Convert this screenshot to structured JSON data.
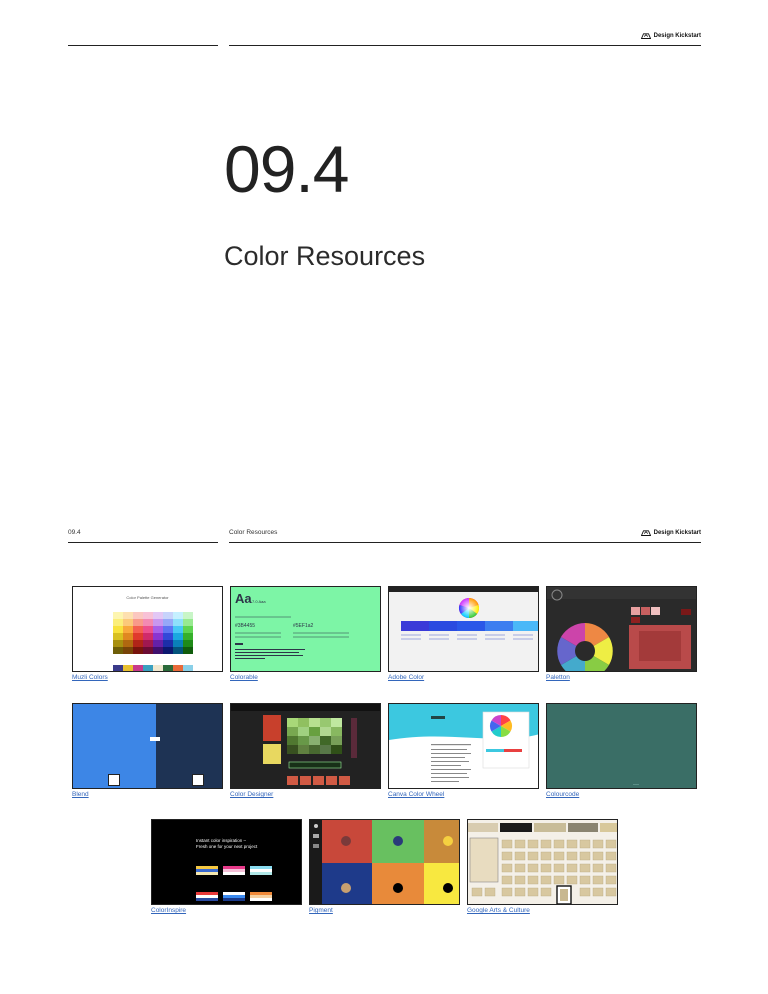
{
  "page1": {
    "brand": "Design Kickstart",
    "chapter_number": "09.4",
    "chapter_title": "Color Resources"
  },
  "page2": {
    "section_number": "09.4",
    "section_title": "Color Resources",
    "brand": "Design Kickstart",
    "resources": [
      {
        "name": "Muzli Colors"
      },
      {
        "name": "Colorable"
      },
      {
        "name": "Adobe Color"
      },
      {
        "name": "Paletton"
      },
      {
        "name": "Blend"
      },
      {
        "name": "Color Designer"
      },
      {
        "name": "Canva Color Wheel"
      },
      {
        "name": "Colourcode"
      },
      {
        "name": "ColorInspire"
      },
      {
        "name": "Pigment"
      },
      {
        "name": "Google Arts & Culture"
      }
    ]
  },
  "thumbnails": {
    "muzli": {
      "title": "Color Palette Generator"
    },
    "colorable": {
      "heading": "Aa",
      "ratio": "7.0 Aaa",
      "color_a": "#3B4455",
      "color_b": "#5EF1a2"
    },
    "colorinspire": {
      "headline_1": "Instant color inspiration –",
      "headline_2": "Fresh one for your next project"
    }
  },
  "colors": {
    "rule": "#222222",
    "link": "#3366bb",
    "colorable_bg": "#7df5a6",
    "blend_left": "#3d86e6",
    "blend_right": "#1e3354",
    "colourcode_bg": "#3a6e66"
  }
}
